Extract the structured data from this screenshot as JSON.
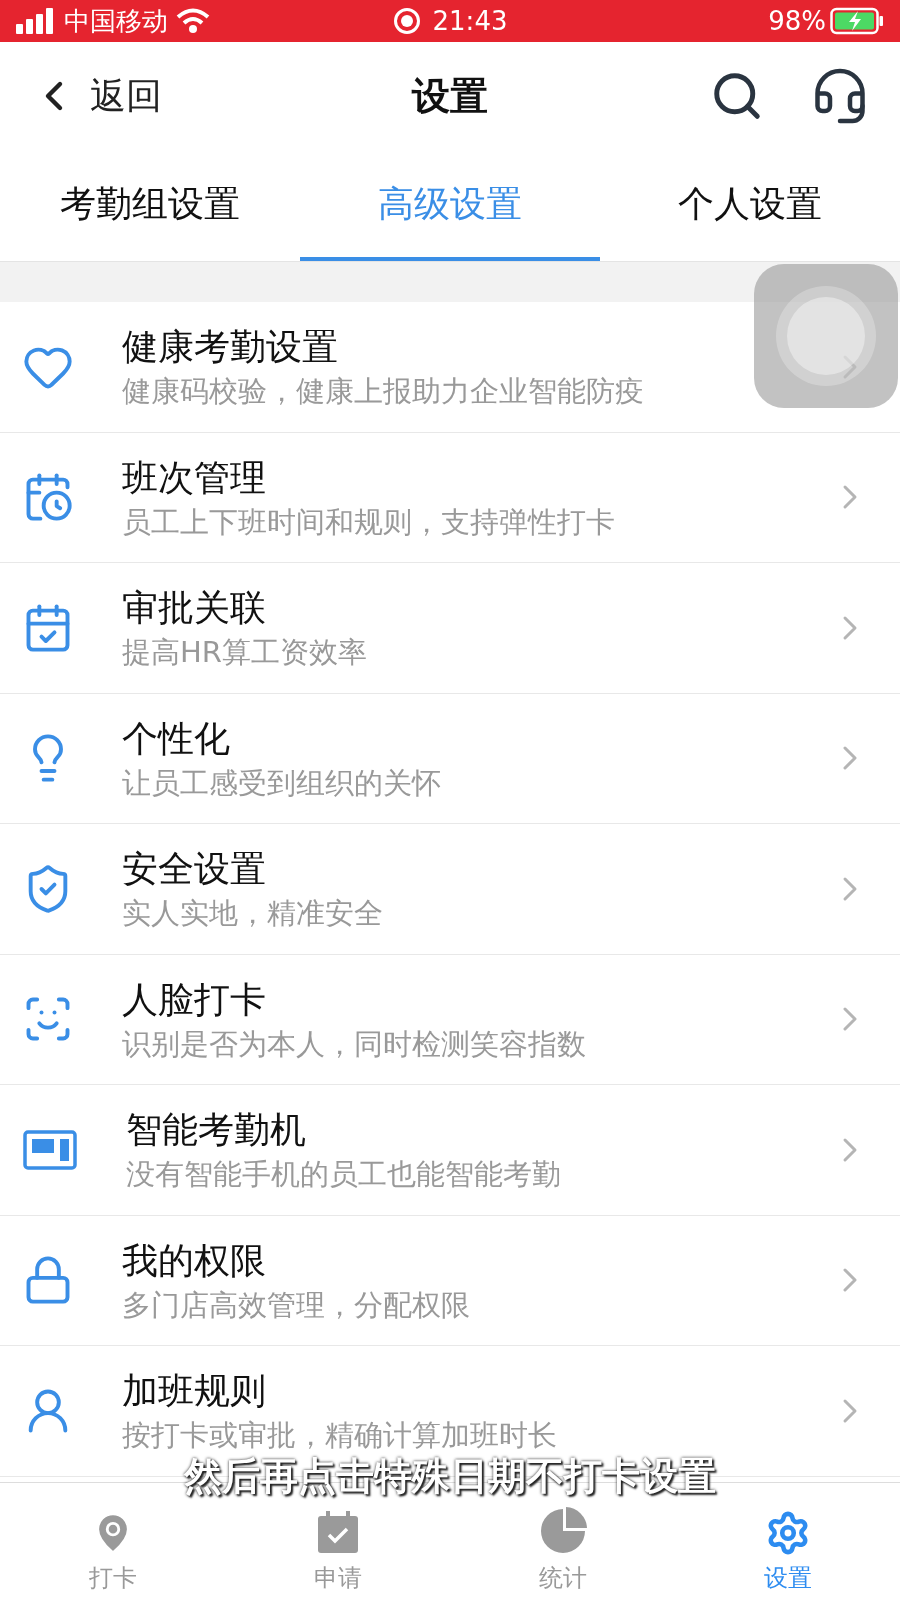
{
  "status_bar": {
    "carrier": "中国移动",
    "time": "21:43",
    "battery": "98%"
  },
  "header": {
    "back": "返回",
    "title": "设置"
  },
  "tabs": [
    {
      "label": "考勤组设置",
      "selected": false
    },
    {
      "label": "高级设置",
      "selected": true
    },
    {
      "label": "个人设置",
      "selected": false
    }
  ],
  "items": [
    {
      "kind": "heart",
      "title": "健康考勤设置",
      "subtitle": "健康码校验，健康上报助力企业智能防疫"
    },
    {
      "kind": "schedule",
      "title": "班次管理",
      "subtitle": "员工上下班时间和规则，支持弹性打卡"
    },
    {
      "kind": "approval",
      "title": "审批关联",
      "subtitle": "提高HR算工资效率"
    },
    {
      "kind": "bulb",
      "title": "个性化",
      "subtitle": "让员工感受到组织的关怀"
    },
    {
      "kind": "shield",
      "title": "安全设置",
      "subtitle": "实人实地，精准安全"
    },
    {
      "kind": "face",
      "title": "人脸打卡",
      "subtitle": "识别是否为本人，同时检测笑容指数"
    },
    {
      "kind": "machine",
      "title": "智能考勤机",
      "subtitle": "没有智能手机的员工也能智能考勤"
    },
    {
      "kind": "lock",
      "title": "我的权限",
      "subtitle": "多门店高效管理，分配权限"
    },
    {
      "kind": "overtime",
      "title": "加班规则",
      "subtitle": "按打卡或审批，精确计算加班时长"
    }
  ],
  "caption": "然后再点击特殊日期不打卡设置",
  "bottom_nav": [
    {
      "kind": "pin",
      "label": "打卡",
      "selected": false
    },
    {
      "kind": "apply",
      "label": "申请",
      "selected": false
    },
    {
      "kind": "stats",
      "label": "统计",
      "selected": false
    },
    {
      "kind": "gear",
      "label": "设置",
      "selected": true
    }
  ]
}
